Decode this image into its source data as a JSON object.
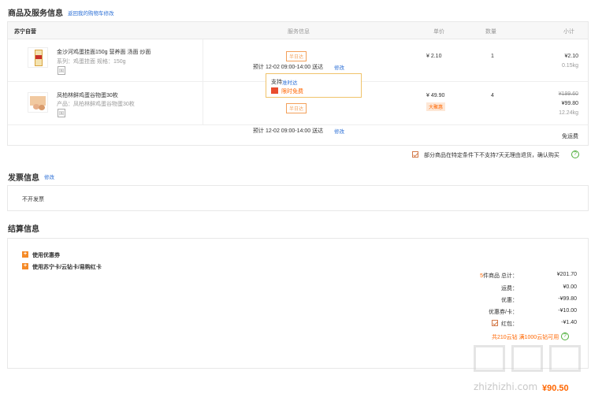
{
  "goods": {
    "title": "商品及服务信息",
    "back_link": "返回我的购物车修改",
    "store": "苏宁自营",
    "headers": {
      "service": "服务信息",
      "price": "单价",
      "qty": "数量",
      "subtotal": "小计"
    },
    "items": [
      {
        "name": "金沙河鸡蛋挂面150g 营养面 汤面 炒面",
        "attr": "系列：鸡蛋挂面   规格：150g",
        "badge": "国",
        "day_tag": "半日达",
        "delivery": "预计 12-02 09:00-14:00 送达",
        "delivery_edit": "修改",
        "price": "¥ 2.10",
        "qty": "1",
        "subtotal": "¥2.10",
        "weight": "0.15kg"
      },
      {
        "name": "凤柏林鲜鸡蛋谷物蛋30枚",
        "attr": "产品：凤柏林鲜鸡蛋谷物蛋30枚",
        "badge": "国",
        "day_tag": "半日达",
        "delivery": "预计 12-02 09:00-14:00 送达",
        "delivery_edit": "修改",
        "price": "¥ 49.90",
        "price_tag": "大聚惠",
        "qty": "4",
        "subtotal_original": "¥199.60",
        "subtotal": "¥99.80",
        "weight": "12.24kg"
      }
    ],
    "popup": {
      "support_prefix": "支持",
      "support_link": "准时达",
      "flag_text": "限时免费"
    },
    "shipping": "免运费",
    "return_notice": "部分商品在特定条件下不支持7天无理由退货，确认购买"
  },
  "invoice": {
    "title": "发票信息",
    "edit": "修改",
    "value": "不开发票"
  },
  "settle": {
    "title": "结算信息",
    "coupon": "使用优惠券",
    "card": "使用苏宁卡/云钻卡/易购红卡",
    "summary": [
      {
        "label": "5件商品 总计：",
        "value": "¥201.70"
      },
      {
        "label": "运费：",
        "value": "¥0.00"
      },
      {
        "label": "优惠：",
        "value": "-¥99.80"
      },
      {
        "label": "优惠券/卡：",
        "value": "-¥10.00"
      },
      {
        "label": "红包：",
        "value": "-¥1.40"
      }
    ],
    "points_line": "共210云钻 满1000云钻可用",
    "total_value": "¥90.50"
  },
  "watermark": "zhizhizhi.com"
}
